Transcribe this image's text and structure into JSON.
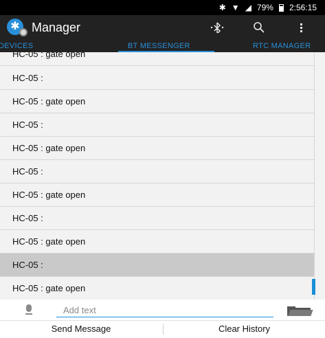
{
  "status_bar": {
    "bluetooth_icon": "bluetooth-icon",
    "wifi_icon": "wifi-icon",
    "signal_icon": "signal-icon",
    "battery": "79%",
    "time": "2:56:15"
  },
  "action_bar": {
    "title": "Manager",
    "icons": [
      "bluetooth-connect-icon",
      "search-icon",
      "overflow-menu-icon"
    ]
  },
  "tabs": [
    {
      "label": "DEVICES"
    },
    {
      "label": "BT MESSENGER",
      "active": true
    },
    {
      "label": "RTC MANAGER"
    }
  ],
  "messages": [
    {
      "text": "HC-05 : gate open"
    },
    {
      "text": "HC-05 :"
    },
    {
      "text": "HC-05 : gate open"
    },
    {
      "text": "HC-05 :"
    },
    {
      "text": "HC-05 : gate open"
    },
    {
      "text": "HC-05 :"
    },
    {
      "text": "HC-05 : gate open"
    },
    {
      "text": "HC-05 :"
    },
    {
      "text": "HC-05 : gate open"
    },
    {
      "text": "HC-05 :",
      "selected": true
    },
    {
      "text": "HC-05 : gate open"
    }
  ],
  "composer": {
    "placeholder": "Add text",
    "value": ""
  },
  "buttons": {
    "send": "Send Message",
    "clear": "Clear History"
  },
  "colors": {
    "accent": "#1a8fd6",
    "actionbar": "#222222",
    "selected_row": "#c9c9c9"
  }
}
